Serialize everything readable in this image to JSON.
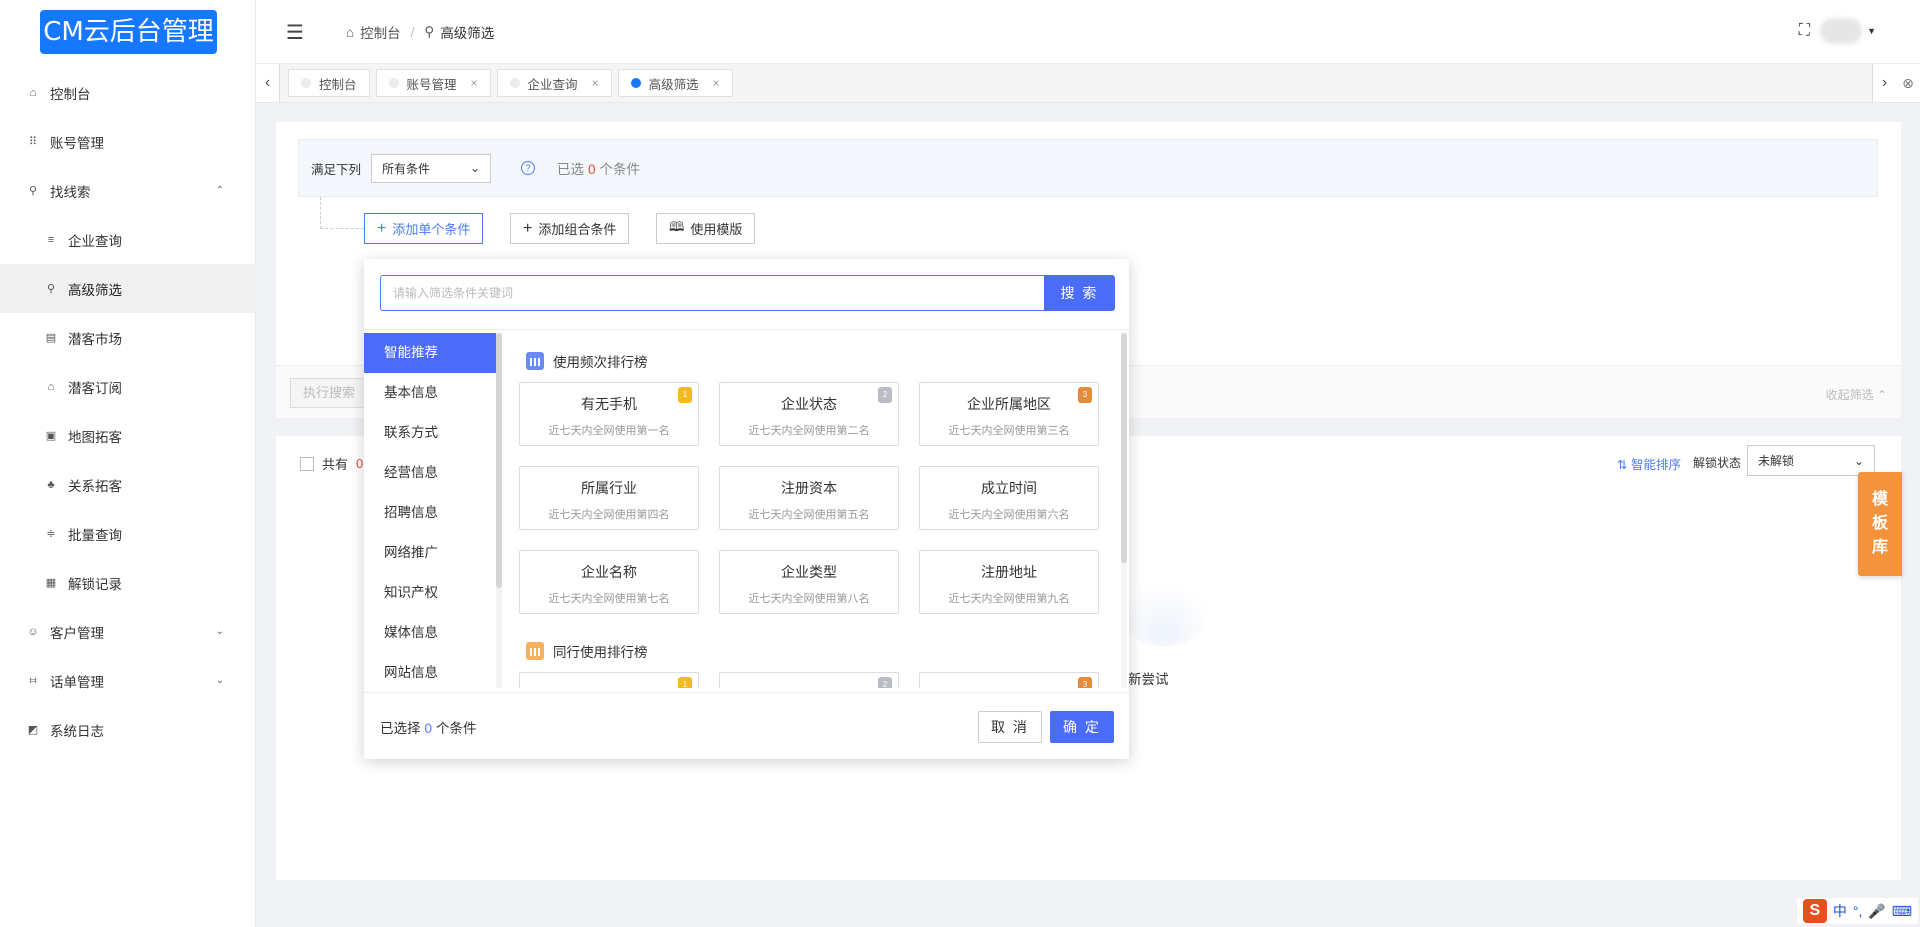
{
  "app": {
    "logo": "CM云后台管理"
  },
  "sidebar": {
    "items": [
      {
        "label": "控制台",
        "icon": "⌂"
      },
      {
        "label": "账号管理",
        "icon": "⠿"
      },
      {
        "label": "找线索",
        "icon": "⚲",
        "arrow": "⌃"
      },
      {
        "label": "企业查询",
        "icon": "≡"
      },
      {
        "label": "高级筛选",
        "icon": "⚲"
      },
      {
        "label": "潜客市场",
        "icon": "▤"
      },
      {
        "label": "潜客订阅",
        "icon": "⌂"
      },
      {
        "label": "地图拓客",
        "icon": "▣"
      },
      {
        "label": "关系拓客",
        "icon": "♣"
      },
      {
        "label": "批量查询",
        "icon": "≑"
      },
      {
        "label": "解锁记录",
        "icon": "▦"
      },
      {
        "label": "客户管理",
        "icon": "☺",
        "arrow": "⌄"
      },
      {
        "label": "话单管理",
        "icon": "⧦",
        "arrow": "⌄"
      },
      {
        "label": "系统日志",
        "icon": "◩"
      }
    ]
  },
  "header": {
    "hamburger": "☰",
    "breadcrumb": [
      "控制台",
      "/",
      "高级筛选"
    ],
    "fullscreen_icon": "⛶",
    "caret": "▼"
  },
  "tabs": [
    {
      "label": "控制台",
      "close": ""
    },
    {
      "label": "账号管理",
      "close": "×"
    },
    {
      "label": "企业查询",
      "close": "×"
    },
    {
      "label": "高级筛选",
      "close": "×"
    }
  ],
  "tabbar": {
    "left": "‹",
    "right": "›",
    "close_all": "⊗"
  },
  "filter": {
    "satisfy_label": "满足下列",
    "condition_select": "所有条件",
    "selected_prefix": "已选",
    "selected_count": "0",
    "selected_suffix": "个条件",
    "add_single": "添加单个条件",
    "add_group": "添加组合条件",
    "use_template": "使用模版",
    "execute": "执行搜索",
    "collapse": "收起筛选 ⌃"
  },
  "results": {
    "total_prefix": "共有",
    "total_count": "0",
    "smart_sort": "⇅ 智能排序",
    "unlock_label": "解锁状态",
    "unlock_select": "未解锁",
    "retry": "新尝试"
  },
  "template_lib": [
    "模",
    "板",
    "库"
  ],
  "modal": {
    "search_placeholder": "请输入筛选条件关键词",
    "search_button": "搜 索",
    "categories": [
      "智能推荐",
      "基本信息",
      "联系方式",
      "经营信息",
      "招聘信息",
      "网络推广",
      "知识产权",
      "媒体信息",
      "网站信息"
    ],
    "section1": "使用频次排行榜",
    "section2": "同行使用排行榜",
    "cards": [
      {
        "name": "有无手机",
        "desc": "近七天内全网使用第一名",
        "medal": "gold"
      },
      {
        "name": "企业状态",
        "desc": "近七天内全网使用第二名",
        "medal": "silver"
      },
      {
        "name": "企业所属地区",
        "desc": "近七天内全网使用第三名",
        "medal": "bronze"
      },
      {
        "name": "所属行业",
        "desc": "近七天内全网使用第四名",
        "medal": ""
      },
      {
        "name": "注册资本",
        "desc": "近七天内全网使用第五名",
        "medal": ""
      },
      {
        "name": "成立时间",
        "desc": "近七天内全网使用第六名",
        "medal": ""
      },
      {
        "name": "企业名称",
        "desc": "近七天内全网使用第七名",
        "medal": ""
      },
      {
        "name": "企业类型",
        "desc": "近七天内全网使用第八名",
        "medal": ""
      },
      {
        "name": "注册地址",
        "desc": "近七天内全网使用第九名",
        "medal": ""
      }
    ],
    "selected_prefix": "已选择",
    "selected_count": "0",
    "selected_suffix": "个条件",
    "cancel": "取 消",
    "confirm": "确 定"
  },
  "ime": {
    "logo": "S",
    "items": [
      "中",
      "°,",
      "🎤",
      "⌨"
    ]
  }
}
